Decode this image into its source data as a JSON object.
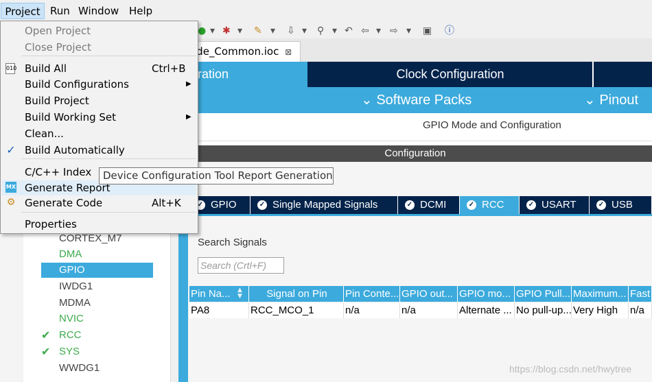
{
  "menubar": {
    "items": [
      "Project",
      "Run",
      "Window",
      "Help"
    ]
  },
  "editor": {
    "tab_label": "ode_Common.ioc",
    "close_glyph": "⊠"
  },
  "header": {
    "tab_partial": "ration",
    "tab_clock": "Clock Configuration",
    "software_packs": "Software Packs",
    "pinout": "Pinout",
    "subtitle": "GPIO Mode and Configuration",
    "configuration_bar": "Configuration"
  },
  "categories": [
    {
      "label": "CORTEX_M7",
      "state": "normal",
      "checked": false
    },
    {
      "label": "DMA",
      "state": "green",
      "checked": false
    },
    {
      "label": "GPIO",
      "state": "selected",
      "checked": false
    },
    {
      "label": "IWDG1",
      "state": "normal",
      "checked": false
    },
    {
      "label": "MDMA",
      "state": "normal",
      "checked": false
    },
    {
      "label": "NVIC",
      "state": "green",
      "checked": false
    },
    {
      "label": "RCC",
      "state": "green",
      "checked": true
    },
    {
      "label": "SYS",
      "state": "green",
      "checked": true
    },
    {
      "label": "WWDG1",
      "state": "normal",
      "checked": false
    }
  ],
  "peripheral_tabs": [
    {
      "label": "GPIO",
      "active": false
    },
    {
      "label": "Single Mapped Signals",
      "active": false
    },
    {
      "label": "DCMI",
      "active": false
    },
    {
      "label": "RCC",
      "active": true
    },
    {
      "label": "USART",
      "active": false
    },
    {
      "label": "USB",
      "active": false
    }
  ],
  "search": {
    "label": "Search Signals",
    "placeholder": "Search (Crtl+F)"
  },
  "table": {
    "headers": [
      "Pin Na...",
      "Signal on Pin",
      "Pin Conte...",
      "GPIO out...",
      "GPIO mo...",
      "GPIO Pull...",
      "Maximum...",
      "Fast"
    ],
    "rows": [
      [
        "PA8",
        "RCC_MCO_1",
        "n/a",
        "n/a",
        "Alternate ...",
        "No pull-up...",
        "Very High",
        "n/a"
      ]
    ]
  },
  "project_menu": {
    "items": [
      {
        "label": "Open Project",
        "shortcut": "",
        "disabled": true,
        "submenu": false
      },
      {
        "label": "Close Project",
        "shortcut": "",
        "disabled": true,
        "submenu": false
      },
      {
        "label": "Build All",
        "shortcut": "Ctrl+B",
        "disabled": false,
        "submenu": false
      },
      {
        "label": "Build Configurations",
        "shortcut": "",
        "disabled": false,
        "submenu": true
      },
      {
        "label": "Build Project",
        "shortcut": "",
        "disabled": false,
        "submenu": false
      },
      {
        "label": "Build Working Set",
        "shortcut": "",
        "disabled": false,
        "submenu": true
      },
      {
        "label": "Clean...",
        "shortcut": "",
        "disabled": false,
        "submenu": false
      },
      {
        "label": "Build Automatically",
        "shortcut": "",
        "disabled": false,
        "submenu": false
      },
      {
        "label": "C/C++ Index",
        "shortcut": "",
        "disabled": false,
        "submenu": true
      },
      {
        "label": "Generate Report",
        "shortcut": "",
        "disabled": false,
        "submenu": false
      },
      {
        "label": "Generate Code",
        "shortcut": "Alt+K",
        "disabled": false,
        "submenu": false
      },
      {
        "label": "Properties",
        "shortcut": "",
        "disabled": false,
        "submenu": false
      }
    ],
    "icons": {
      "build_all": "binary-icon",
      "build_auto": "check-icon",
      "report": "mx-icon",
      "gen_code": "gear-icon"
    },
    "mx_text": "MX",
    "bin_text": "010"
  },
  "tooltip": {
    "text": "Device Configuration Tool Report Generation"
  },
  "watermark": "https://blog.csdn.net/hwytree",
  "colors": {
    "dark_blue": "#03234b",
    "light_blue": "#3caadc",
    "green": "#3caa4c"
  }
}
